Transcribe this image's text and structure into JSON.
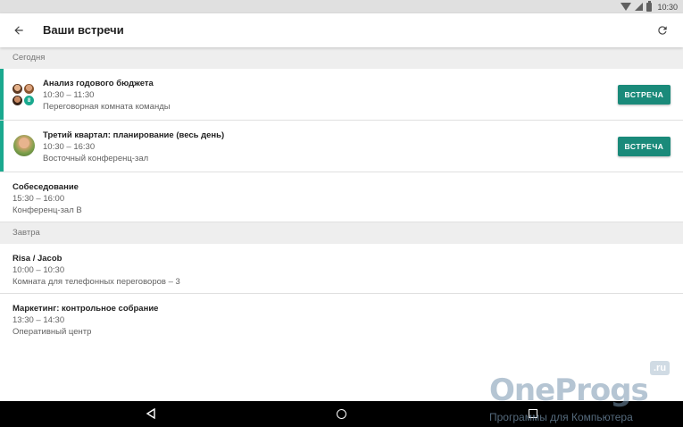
{
  "status_bar": {
    "time": "10:30",
    "icons": [
      "wifi-icon",
      "signal-icon",
      "battery-icon"
    ]
  },
  "app_bar": {
    "title": "Ваши встречи",
    "back_icon": "arrow-back-icon",
    "refresh_icon": "refresh-icon"
  },
  "colors": {
    "accent": "#1aa98f",
    "button": "#1a8a7a",
    "section_bg": "#eeeeee"
  },
  "sections": [
    {
      "header": "Сегодня",
      "events": [
        {
          "title": "Анализ годового бюджета",
          "time": "10:30 – 11:30",
          "room": "Переговорная комната команды",
          "button": "ВСТРЕЧА",
          "avatar_badge": "8"
        },
        {
          "title": "Третий квартал: планирование (весь день)",
          "time": "10:30 – 16:30",
          "room": "Восточный конференц-зал",
          "button": "ВСТРЕЧА"
        },
        {
          "title": "Собеседование",
          "time": "15:30 – 16:00",
          "room": "Конференц-зал B"
        }
      ]
    },
    {
      "header": "Завтра",
      "events": [
        {
          "title": "Risa / Jacob",
          "time": "10:00 – 10:30",
          "room": "Комната для телефонных переговоров – 3"
        },
        {
          "title": "Маркетинг: контрольное собрание",
          "time": "13:30 – 14:30",
          "room": "Оперативный центр"
        }
      ]
    }
  ],
  "watermark": {
    "name": "OneProgs",
    "domain": ".ru",
    "tagline": "Программы для Компьютера"
  }
}
